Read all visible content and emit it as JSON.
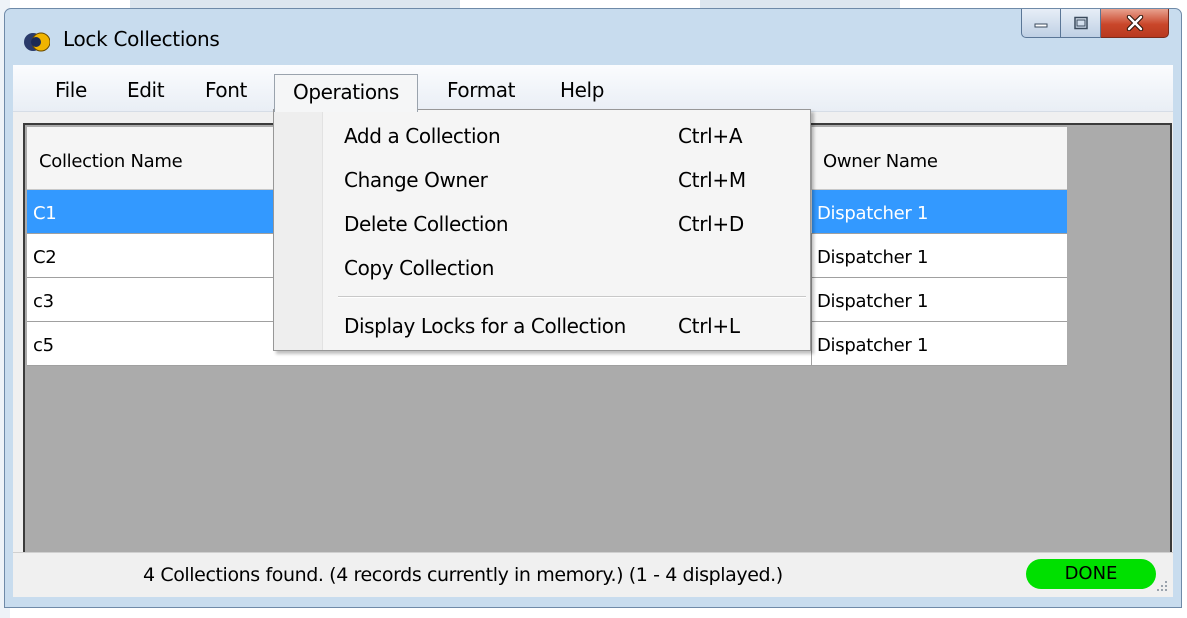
{
  "window": {
    "title": "Lock Collections"
  },
  "menu": {
    "items": [
      {
        "label": "File"
      },
      {
        "label": "Edit"
      },
      {
        "label": "Font"
      },
      {
        "label": "Operations"
      },
      {
        "label": "Format"
      },
      {
        "label": "Help"
      }
    ]
  },
  "operations_menu": {
    "items": [
      {
        "label": "Add a Collection",
        "shortcut": "Ctrl+A"
      },
      {
        "label": "Change Owner",
        "shortcut": "Ctrl+M"
      },
      {
        "label": "Delete Collection",
        "shortcut": "Ctrl+D"
      },
      {
        "label": "Copy Collection",
        "shortcut": ""
      },
      {
        "label": "Display Locks for a Collection",
        "shortcut": "Ctrl+L"
      }
    ]
  },
  "grid": {
    "columns": [
      "Collection Name",
      "Owner Name"
    ],
    "rows": [
      {
        "name": "C1",
        "owner": "Dispatcher 1",
        "selected": true
      },
      {
        "name": "C2",
        "owner": "Dispatcher 1",
        "selected": false
      },
      {
        "name": "c3",
        "owner": "Dispatcher 1",
        "selected": false
      },
      {
        "name": "c5",
        "owner": "Dispatcher 1",
        "selected": false
      }
    ]
  },
  "status": {
    "text": "4 Collections found.  (4 records currently in memory.)  (1 - 4 displayed.)",
    "badge": "DONE"
  },
  "colors": {
    "selection": "#3399ff",
    "done_badge": "#00e000",
    "grid_background": "#ababab"
  }
}
